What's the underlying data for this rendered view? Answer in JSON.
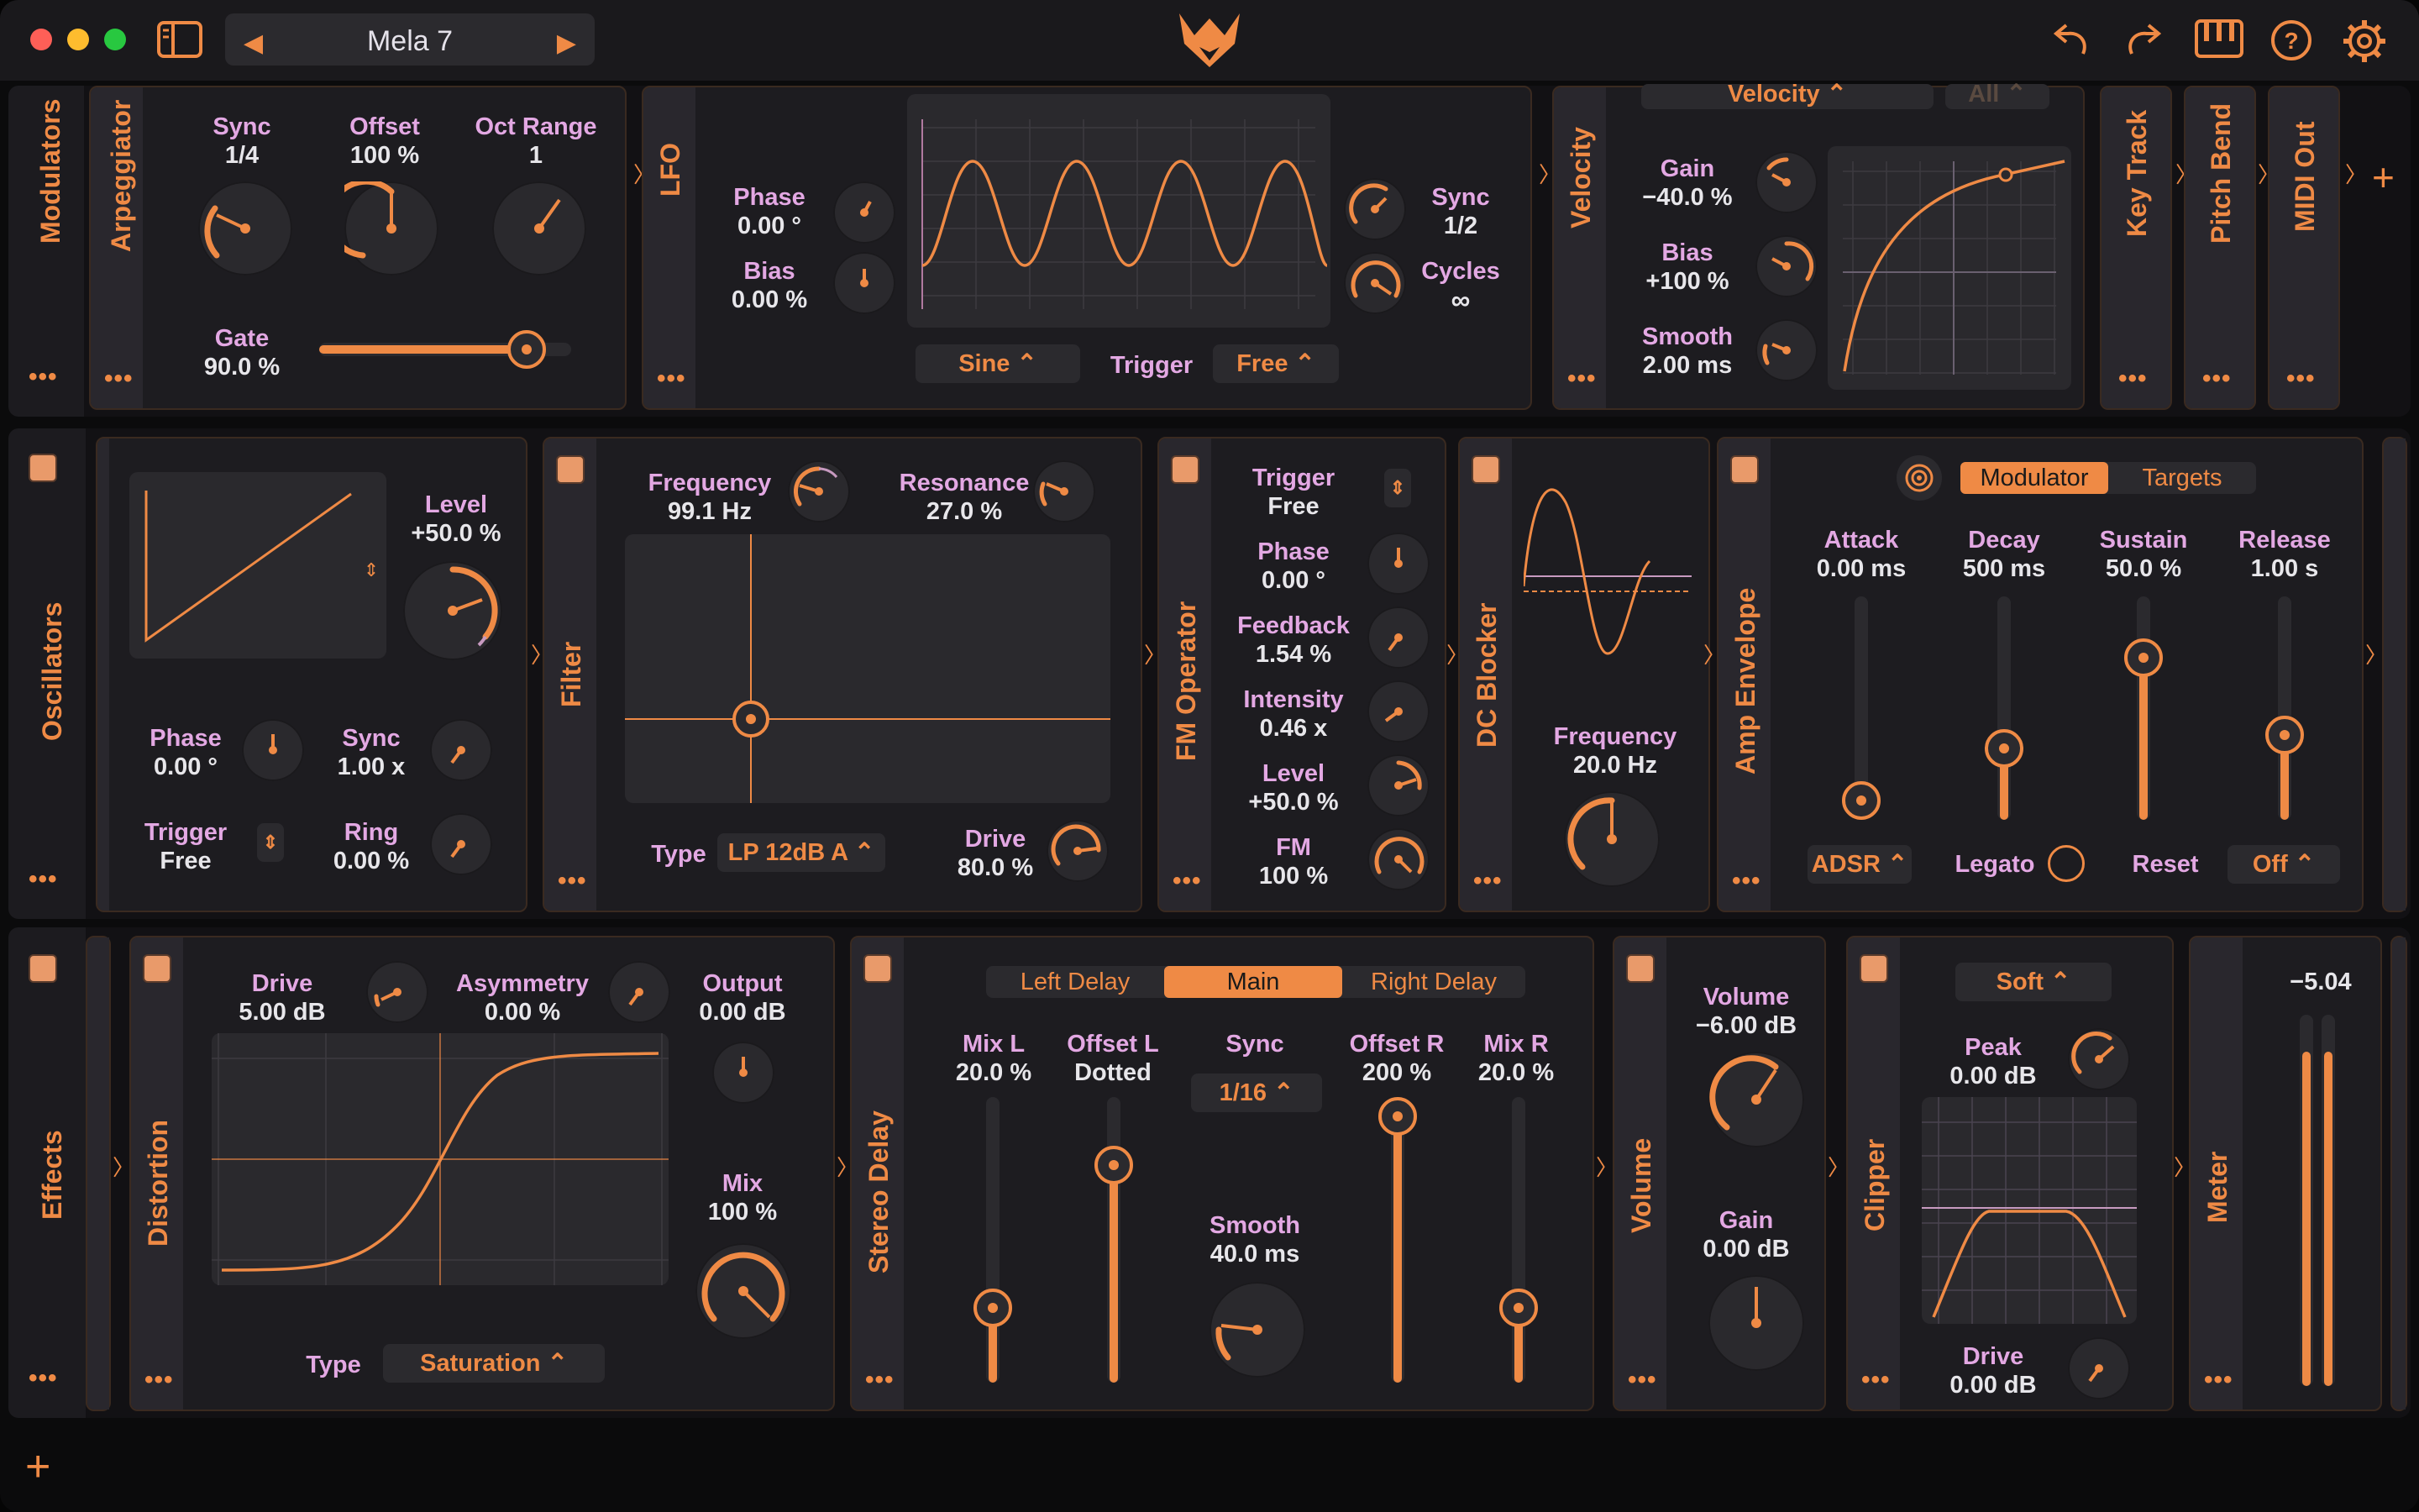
{
  "titlebar": {
    "preset": "Mela 7"
  },
  "modulators": {
    "title": "Modulators",
    "arpeggiator": {
      "title": "Arpeggiator",
      "sync_label": "Sync",
      "sync_value": "1/4",
      "offset_label": "Offset",
      "offset_value": "100 %",
      "oct_label": "Oct Range",
      "oct_value": "1",
      "gate_label": "Gate",
      "gate_value": "90.0 %"
    },
    "lfo": {
      "title": "LFO",
      "phase_label": "Phase",
      "phase_value": "0.00 °",
      "bias_label": "Bias",
      "bias_value": "0.00 %",
      "sync_label": "Sync",
      "sync_value": "1/2",
      "cycles_label": "Cycles",
      "cycles_value": "∞",
      "wave": "Sine",
      "trigger_label": "Trigger",
      "trigger_value": "Free"
    },
    "velocity": {
      "title": "Velocity",
      "source": "Velocity",
      "channel": "All",
      "gain_label": "Gain",
      "gain_value": "−40.0 %",
      "bias_label": "Bias",
      "bias_value": "+100 %",
      "smooth_label": "Smooth",
      "smooth_value": "2.00 ms"
    },
    "key_track": "Key Track",
    "pitch_bend": "Pitch Bend",
    "midi_out": "MIDI Out"
  },
  "oscillators": {
    "title": "Oscillators",
    "osc": {
      "level_label": "Level",
      "level_value": "+50.0 %",
      "phase_label": "Phase",
      "phase_value": "0.00 °",
      "sync_label": "Sync",
      "sync_value": "1.00 x",
      "trigger_label": "Trigger",
      "trigger_value": "Free",
      "ring_label": "Ring",
      "ring_value": "0.00 %"
    },
    "filter": {
      "title": "Filter",
      "freq_label": "Frequency",
      "freq_value": "99.1 Hz",
      "res_label": "Resonance",
      "res_value": "27.0 %",
      "type_label": "Type",
      "type_value": "LP 12dB A",
      "drive_label": "Drive",
      "drive_value": "80.0 %"
    },
    "fm": {
      "title": "FM Operator",
      "trigger_label": "Trigger",
      "trigger_value": "Free",
      "phase_label": "Phase",
      "phase_value": "0.00 °",
      "feedback_label": "Feedback",
      "feedback_value": "1.54 %",
      "intensity_label": "Intensity",
      "intensity_value": "0.46 x",
      "level_label": "Level",
      "level_value": "+50.0 %",
      "fm_label": "FM",
      "fm_value": "100 %"
    },
    "dc": {
      "title": "DC Blocker",
      "freq_label": "Frequency",
      "freq_value": "20.0 Hz"
    },
    "amp": {
      "title": "Amp Envelope",
      "tab_modulator": "Modulator",
      "tab_targets": "Targets",
      "attack_label": "Attack",
      "attack_value": "0.00 ms",
      "decay_label": "Decay",
      "decay_value": "500 ms",
      "sustain_label": "Sustain",
      "sustain_value": "50.0 %",
      "release_label": "Release",
      "release_value": "1.00 s",
      "mode": "ADSR",
      "legato_label": "Legato",
      "reset_label": "Reset",
      "reset_value": "Off"
    }
  },
  "effects": {
    "title": "Effects",
    "distortion": {
      "title": "Distortion",
      "drive_label": "Drive",
      "drive_value": "5.00 dB",
      "asym_label": "Asymmetry",
      "asym_value": "0.00 %",
      "output_label": "Output",
      "output_value": "0.00 dB",
      "mix_label": "Mix",
      "mix_value": "100 %",
      "type_label": "Type",
      "type_value": "Saturation"
    },
    "delay": {
      "title": "Stereo Delay",
      "tab_left": "Left Delay",
      "tab_main": "Main",
      "tab_right": "Right Delay",
      "mixl_label": "Mix L",
      "mixl_value": "20.0 %",
      "offl_label": "Offset L",
      "offl_value": "Dotted",
      "sync_label": "Sync",
      "sync_value": "1/16",
      "offr_label": "Offset R",
      "offr_value": "200 %",
      "mixr_label": "Mix R",
      "mixr_value": "20.0 %",
      "smooth_label": "Smooth",
      "smooth_value": "40.0 ms"
    },
    "volume": {
      "title": "Volume",
      "vol_label": "Volume",
      "vol_value": "−6.00 dB",
      "gain_label": "Gain",
      "gain_value": "0.00 dB"
    },
    "clipper": {
      "title": "Clipper",
      "mode": "Soft",
      "peak_label": "Peak",
      "peak_value": "0.00 dB",
      "drive_label": "Drive",
      "drive_value": "0.00 dB"
    },
    "meter": {
      "title": "Meter",
      "value": "−5.04"
    }
  }
}
